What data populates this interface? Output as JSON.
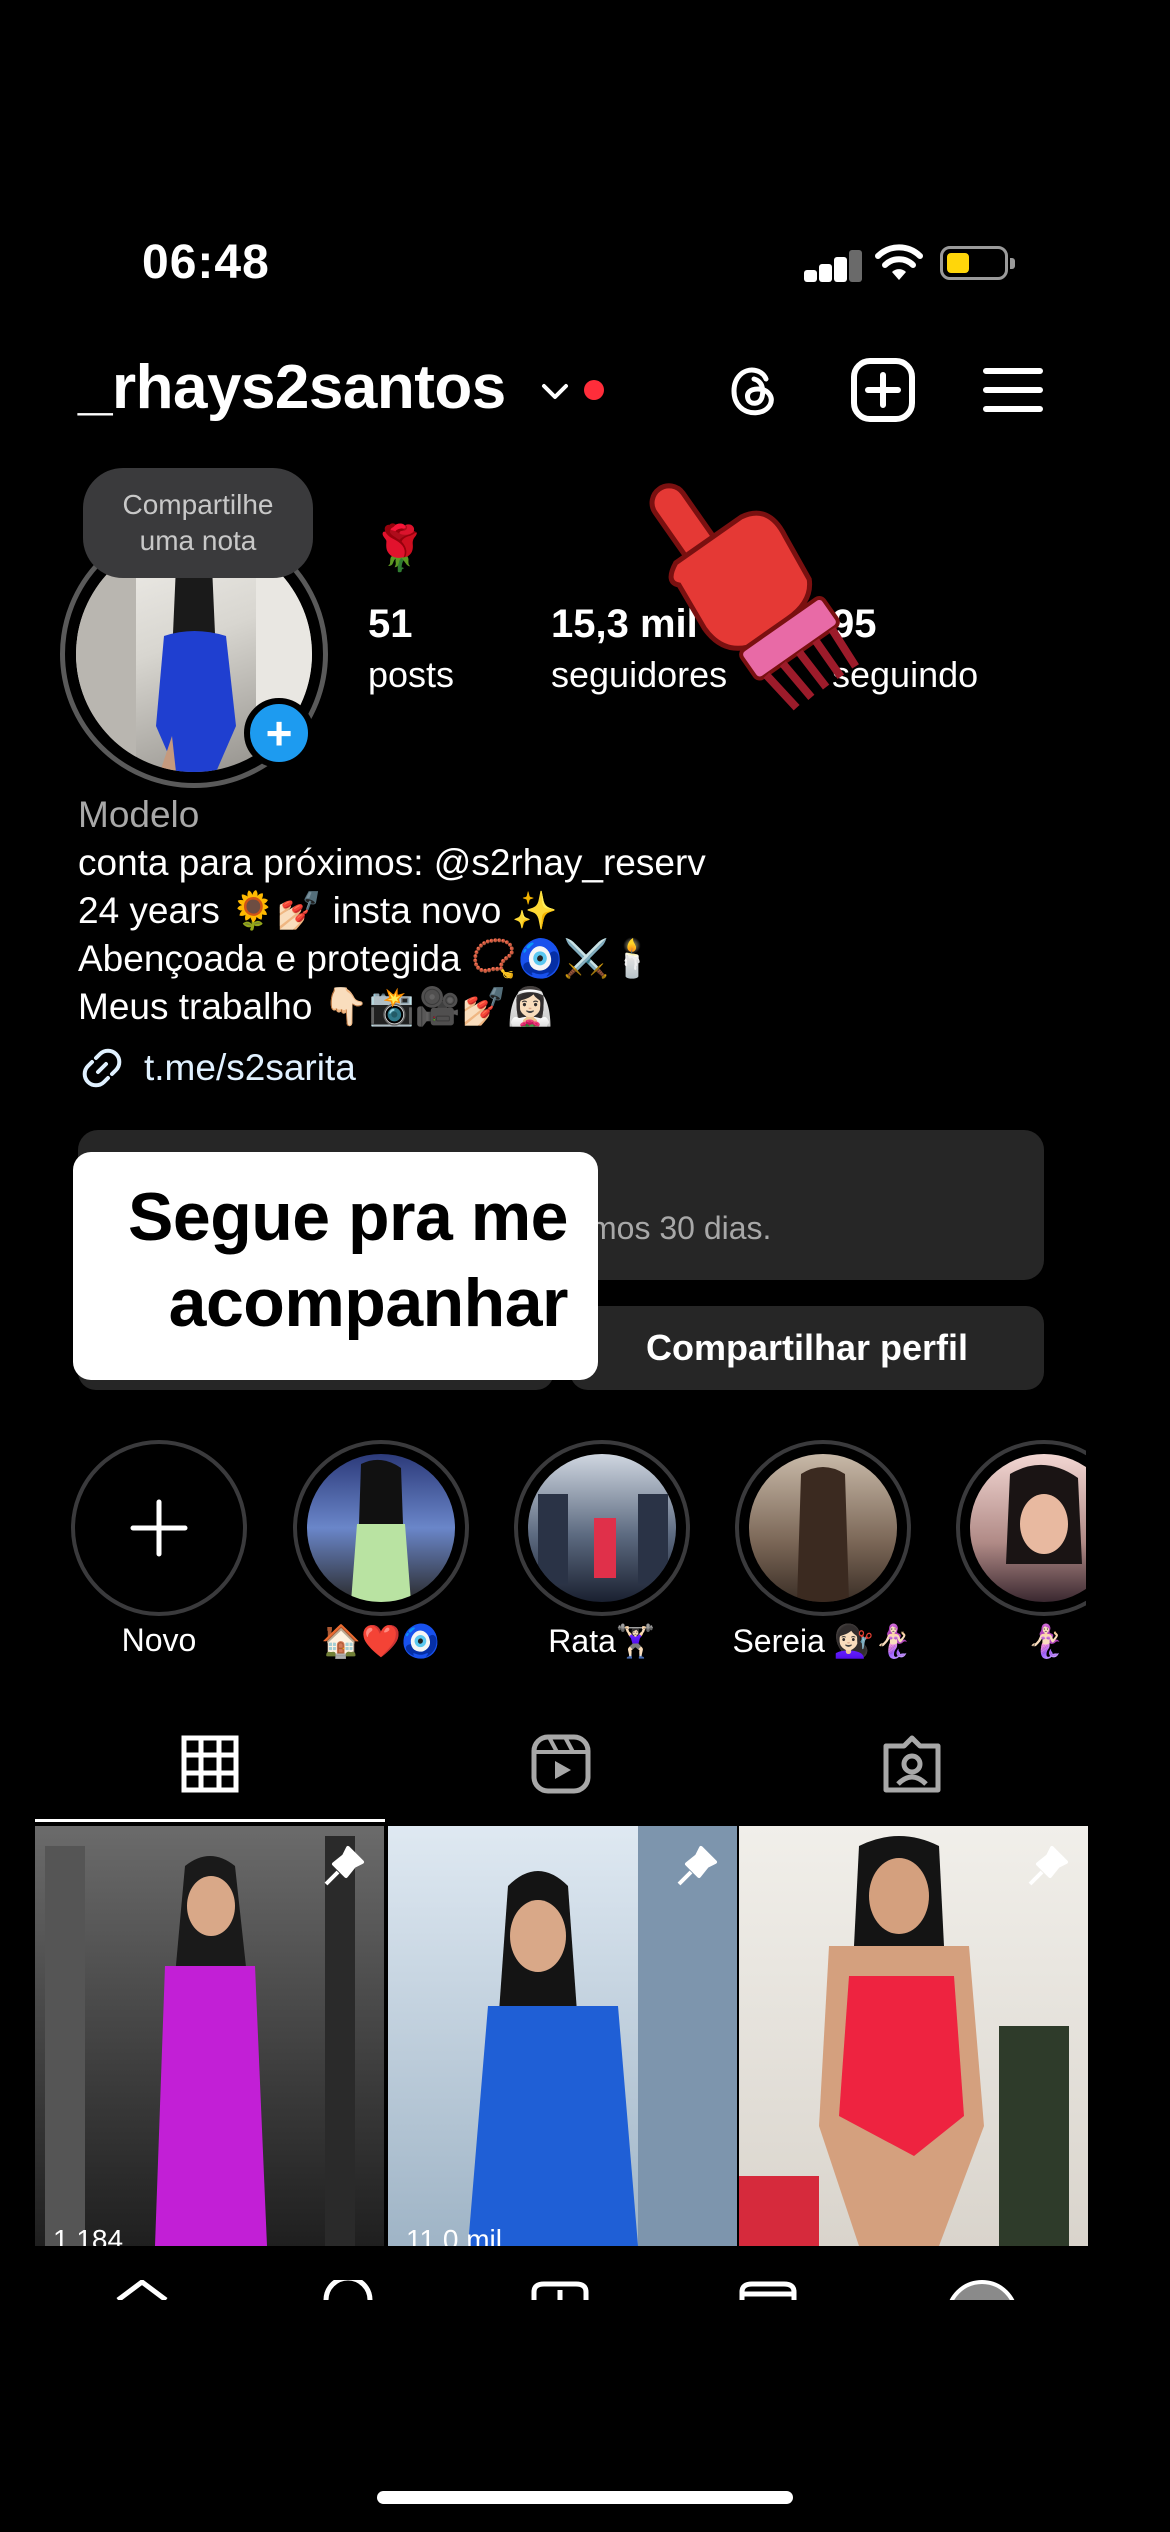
{
  "status_bar": {
    "time": "06:48"
  },
  "header": {
    "username": "_rhays2santos"
  },
  "profile": {
    "note": "Compartilhe uma nota",
    "rose": "🌹",
    "stats": [
      {
        "value": "51",
        "label": "posts"
      },
      {
        "value": "15,3 mil",
        "label": "seguidores"
      },
      {
        "value": "95",
        "label": "seguindo"
      }
    ]
  },
  "bio": {
    "category": "Modelo",
    "lines": [
      "conta para próximos: @s2rhay_reserv",
      "24 years 🌻💅🏻 insta novo ✨",
      "Abençoada e protegida 📿🧿⚔️🕯️",
      "Meus trabalho 👇🏻📸🎥💅🏻👰🏻‍♀️"
    ],
    "link": "t.me/s2sarita"
  },
  "dashboard": {
    "text_visible": "mos 30 dias."
  },
  "buttons": {
    "share_profile": "Compartilhar perfil"
  },
  "sticker": {
    "line1": "Segue pra me",
    "line2": "acompanhar"
  },
  "highlights": [
    {
      "label": "Novo"
    },
    {
      "label": "🏠❤️🧿"
    },
    {
      "label": "Rata🏋🏻‍♀️"
    },
    {
      "label": "Sereia 💇🏻‍♀️🧜🏻‍♀️"
    },
    {
      "label": "🧜🏻‍♀️"
    }
  ],
  "posts": [
    {
      "views": "1.184",
      "outfit_color": "#c21fd6"
    },
    {
      "views": "11,0 mil",
      "outfit_color": "#1f5fd6"
    },
    {
      "views": "",
      "outfit_color": "#ee2340"
    }
  ],
  "colors": {
    "background": "#000000",
    "accent_blue": "#1d9bf0",
    "surface": "#262626",
    "live_dot": "#ff2d3a"
  }
}
